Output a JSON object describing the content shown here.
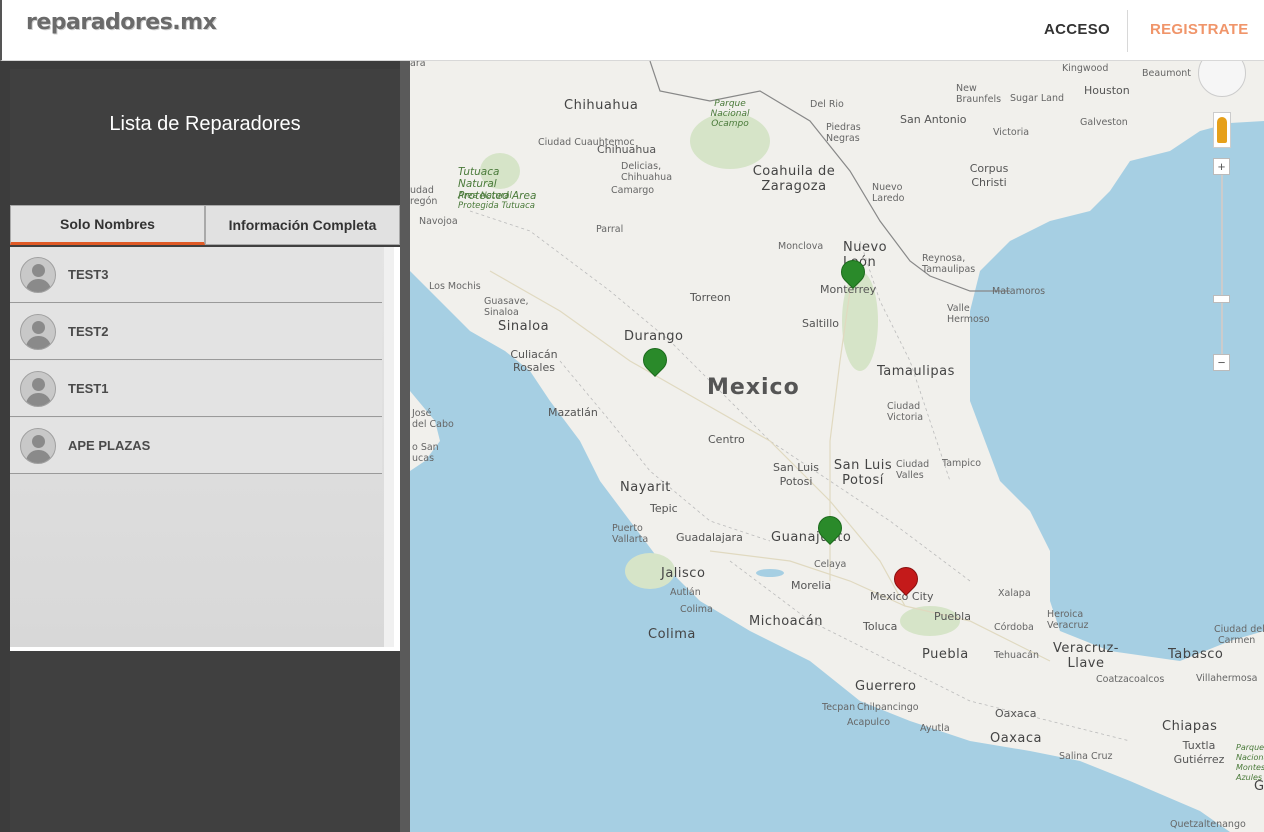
{
  "header": {
    "logo": "reparadores.mx",
    "acceso": "ACCESO",
    "registrate": "REGISTRATE",
    "registrate_color": "#f0956a"
  },
  "sidebar": {
    "title": "Lista de Reparadores",
    "tabs": [
      {
        "label": "Solo Nombres",
        "active": true
      },
      {
        "label": "Información Completa",
        "active": false
      }
    ],
    "accent_color": "#e05a26",
    "items": [
      {
        "name": "TEST3",
        "icon": "avatar-icon"
      },
      {
        "name": "TEST2",
        "icon": "avatar-icon"
      },
      {
        "name": "TEST1",
        "icon": "avatar-icon"
      },
      {
        "name": "APE PLAZAS",
        "icon": "avatar-icon"
      }
    ]
  },
  "map": {
    "country": "Mexico",
    "states": [
      "Chihuahua",
      "Coahuila de Zaragoza",
      "Nuevo León",
      "Durango",
      "Sinaloa",
      "Tamaulipas",
      "Nayarit",
      "Jalisco",
      "Colima",
      "Michoacán",
      "Guerrero",
      "Oaxaca",
      "Chiapas",
      "Tabasco",
      "Veracruz-Llave",
      "Puebla",
      "San Luis Potosí",
      "Guanajuato"
    ],
    "cities": [
      "Ciudad Cuauhtemoc",
      "Chihuahua",
      "Delicias, Chihuahua",
      "Camargo",
      "Parral",
      "Navojoa",
      "Los Mochis",
      "Guasave, Sinaloa",
      "Culiacán Rosales",
      "Mazatlán",
      "Torreon",
      "Monclova",
      "Monterrey",
      "Saltillo",
      "Reynosa, Tamaulipas",
      "Matamoros",
      "Valle Hermoso",
      "Ciudad Victoria",
      "Tampico",
      "Ciudad Valles",
      "Centro",
      "San Luis Potosi",
      "Tepic",
      "Puerto Vallarta",
      "Guadalajara",
      "Autlán",
      "Colima",
      "Celaya",
      "Morelia",
      "Toluca",
      "Mexico City",
      "Puebla",
      "Xalapa",
      "Heroica Veracruz",
      "Córdoba",
      "Tehuacán",
      "Coatzacoalcos",
      "Villahermosa",
      "Tecpan",
      "Chilpancingo",
      "Acapulco",
      "Ayutla",
      "Oaxaca",
      "Salina Cruz",
      "Tuxtla Gutiérrez",
      "Quetzaltenango",
      "San Antonio",
      "Houston",
      "Victoria",
      "Corpus Christi",
      "Galveston",
      "New Braunfels",
      "Sugar Land",
      "Kingwood",
      "Beaumont",
      "Del Rio",
      "Piedras Negras",
      "Nuevo Laredo",
      "Ciudad del Carmen",
      "San José del Cabo",
      "Cabo San Lucas",
      "Ciudad Obregón"
    ],
    "parks": [
      "Parque Nacional Ocampo",
      "Tutuaca Natural Protected Area",
      "Area Natural Protegida Tutuaca",
      "Parque Nacional Montes Azules"
    ],
    "map_labels_misc": [
      "udad",
      "regón",
      "ara",
      "José",
      "del Cabo",
      "o San",
      "ucas",
      "Ciudad del",
      "Carmen",
      "G"
    ],
    "zoom_in": "+",
    "zoom_out": "−"
  }
}
